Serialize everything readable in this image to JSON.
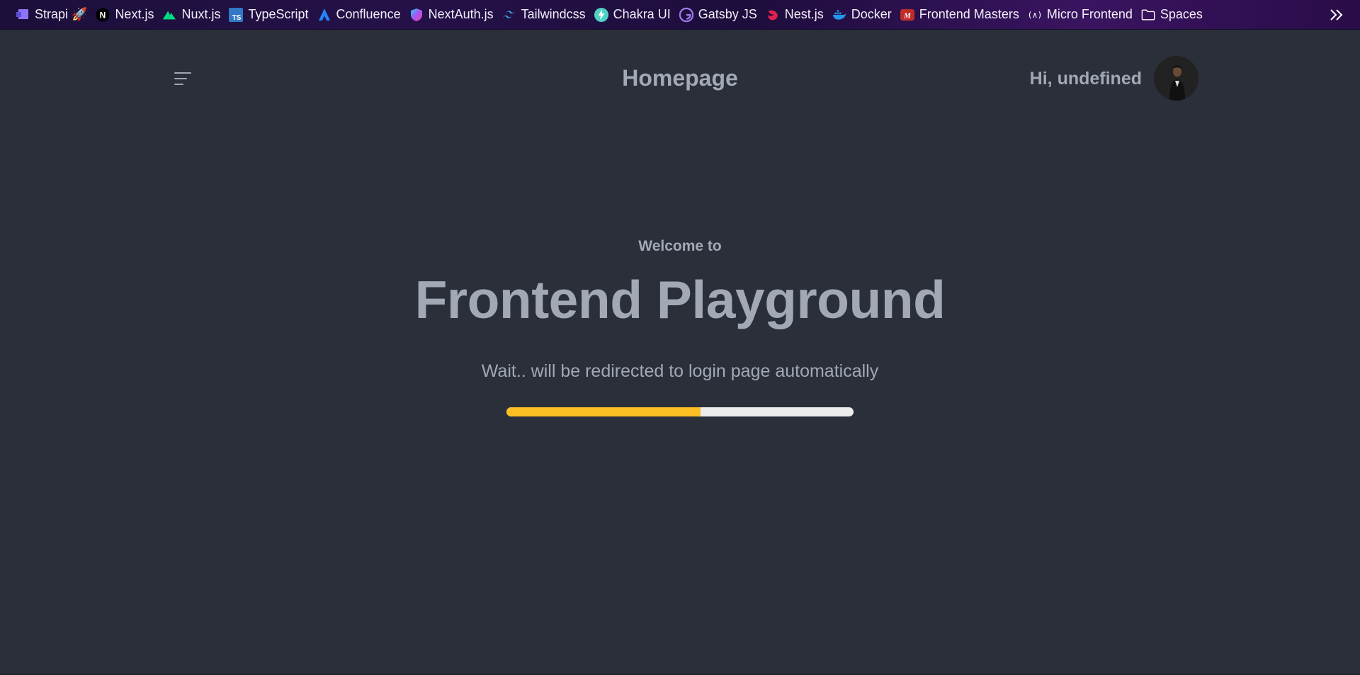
{
  "bookmarks": [
    {
      "label": "Strapi 🚀",
      "icon": "strapi-icon",
      "color": "#8e75ff"
    },
    {
      "label": "Next.js",
      "icon": "nextjs-icon",
      "color": "#000000"
    },
    {
      "label": "Nuxt.js",
      "icon": "nuxt-icon",
      "color": "#00dc82"
    },
    {
      "label": "TypeScript",
      "icon": "typescript-icon",
      "color": "#3178c6"
    },
    {
      "label": "Confluence",
      "icon": "confluence-icon",
      "color": "#2684ff"
    },
    {
      "label": "NextAuth.js",
      "icon": "nextauth-icon",
      "color": "#a855f7"
    },
    {
      "label": "Tailwindcss",
      "icon": "tailwind-icon",
      "color": "#38bdf8"
    },
    {
      "label": "Chakra UI",
      "icon": "chakra-icon",
      "color": "#319795"
    },
    {
      "label": "Gatsby JS",
      "icon": "gatsby-icon",
      "color": "#663399"
    },
    {
      "label": "Nest.js",
      "icon": "nestjs-icon",
      "color": "#e0234e"
    },
    {
      "label": "Docker",
      "icon": "docker-icon",
      "color": "#2496ed"
    },
    {
      "label": "Frontend Masters",
      "icon": "frontend-masters-icon",
      "color": "#c02d28"
    },
    {
      "label": "Micro Frontend",
      "icon": "react-icon",
      "color": "#ffffff"
    },
    {
      "label": "Spaces",
      "icon": "folder-icon",
      "color": "#ffffff"
    }
  ],
  "header": {
    "title": "Homepage",
    "greeting": "Hi, undefined"
  },
  "hero": {
    "welcome": "Welcome to",
    "title": "Frontend Playground",
    "redirect_message": "Wait.. will be redirected to login page automatically",
    "progress_percent": 56
  },
  "colors": {
    "background": "#2a2f3a",
    "text": "#a3a9b4",
    "progress_fill": "#fbbf24",
    "progress_track": "#ececec"
  }
}
